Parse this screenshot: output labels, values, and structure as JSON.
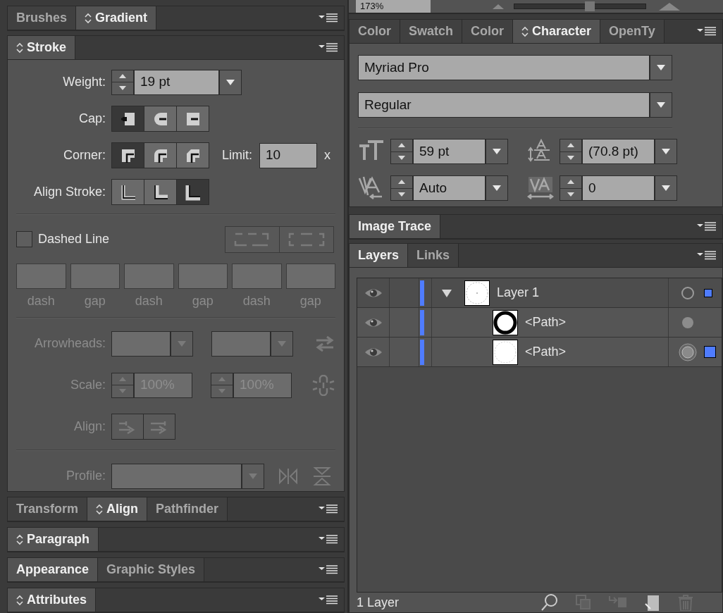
{
  "top_strip": {
    "zoom_field": {
      "value": "173%"
    },
    "zoom_slider": {
      "level": 0.58
    }
  },
  "brushes_group": {
    "tabs": [
      {
        "label": "Brushes",
        "selected": false,
        "toggle": false
      },
      {
        "label": "Gradient",
        "selected": true,
        "toggle": true
      }
    ]
  },
  "stroke_panel": {
    "tabs": [
      {
        "label": "Stroke",
        "selected": true,
        "toggle": true
      }
    ],
    "weight": {
      "label": "Weight:",
      "value": "19 pt"
    },
    "cap": {
      "label": "Cap:",
      "buttons": [
        {
          "kind": "butt",
          "selected": true
        },
        {
          "kind": "round",
          "selected": false
        },
        {
          "kind": "projecting",
          "selected": false
        }
      ]
    },
    "corner": {
      "label": "Corner:",
      "buttons": [
        {
          "kind": "miter",
          "selected": true
        },
        {
          "kind": "round",
          "selected": false
        },
        {
          "kind": "bevel",
          "selected": false
        }
      ]
    },
    "limit": {
      "label": "Limit:",
      "value": "10",
      "unit": "x"
    },
    "align_stroke": {
      "label": "Align Stroke:",
      "buttons": [
        {
          "kind": "center",
          "selected": false
        },
        {
          "kind": "inside",
          "selected": false
        },
        {
          "kind": "outside",
          "selected": true
        }
      ]
    },
    "dashed_line": {
      "label": "Dashed Line",
      "checked": false
    },
    "dash_alignment": {
      "disabled": true,
      "buttons": [
        {
          "kind": "exact"
        },
        {
          "kind": "corners"
        }
      ]
    },
    "dash_pattern": {
      "disabled": true,
      "fields": [
        {
          "label": "dash"
        },
        {
          "label": "gap"
        },
        {
          "label": "dash"
        },
        {
          "label": "gap"
        },
        {
          "label": "dash"
        },
        {
          "label": "gap"
        }
      ]
    },
    "arrowheads": {
      "label": "Arrowheads:",
      "disabled": true
    },
    "scale": {
      "label": "Scale:",
      "disabled": true,
      "start": "100%",
      "end": "100%"
    },
    "arrow_align": {
      "label": "Align:",
      "disabled": true
    },
    "profile": {
      "label": "Profile:",
      "disabled": true
    }
  },
  "transform_group": {
    "tabs": [
      {
        "label": "Transform",
        "selected": false,
        "toggle": false
      },
      {
        "label": "Align",
        "selected": true,
        "toggle": true
      },
      {
        "label": "Pathfinder",
        "selected": false,
        "toggle": false
      }
    ]
  },
  "paragraph_group": {
    "tabs": [
      {
        "label": "Paragraph",
        "selected": true,
        "toggle": true
      }
    ]
  },
  "appearance_group": {
    "tabs": [
      {
        "label": "Appearance",
        "selected": true,
        "toggle": false
      },
      {
        "label": "Graphic Styles",
        "selected": false,
        "toggle": false
      }
    ]
  },
  "attributes_group": {
    "tabs": [
      {
        "label": "Attributes",
        "selected": true,
        "toggle": true
      }
    ]
  },
  "character_group": {
    "tabs": [
      {
        "label": "Color",
        "selected": false,
        "toggle": false
      },
      {
        "label": "Swatch",
        "selected": false,
        "toggle": false
      },
      {
        "label": "Color",
        "selected": false,
        "toggle": false
      },
      {
        "label": "Character",
        "selected": true,
        "toggle": true
      },
      {
        "label": "OpenTy",
        "selected": false,
        "toggle": false
      }
    ],
    "font_family": "Myriad Pro",
    "font_style": "Regular",
    "font_size": "59 pt",
    "leading": "(70.8 pt)",
    "kerning": "Auto",
    "tracking": "0"
  },
  "image_trace_group": {
    "tabs": [
      {
        "label": "Image Trace",
        "selected": true,
        "toggle": false
      }
    ]
  },
  "layers_panel": {
    "tabs": [
      {
        "label": "Layers",
        "selected": true,
        "toggle": false
      },
      {
        "label": "Links",
        "selected": false,
        "toggle": false
      }
    ],
    "layers": [
      {
        "name": "Layer 1",
        "visible": true,
        "expanded": true,
        "targeted": false,
        "selected": true,
        "children": [
          {
            "name": "<Path>",
            "kind": "ring",
            "visible": true,
            "targeted": false,
            "selected": false
          },
          {
            "name": "<Path>",
            "kind": "disc",
            "visible": true,
            "targeted": true,
            "selected": true
          }
        ]
      }
    ],
    "status": "1 Layer"
  }
}
